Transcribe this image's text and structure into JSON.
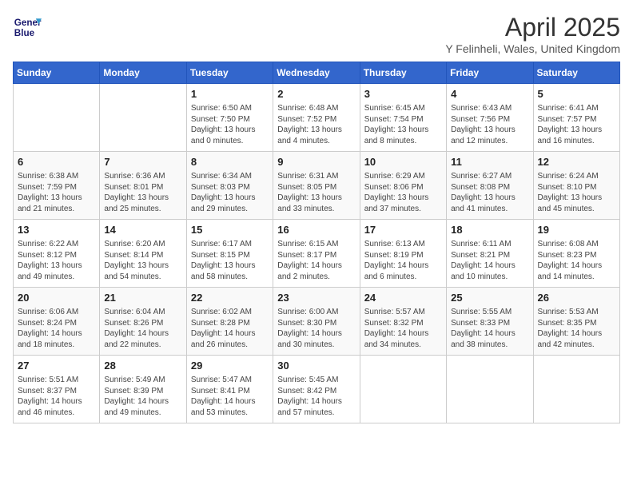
{
  "header": {
    "logo_line1": "General",
    "logo_line2": "Blue",
    "title": "April 2025",
    "subtitle": "Y Felinheli, Wales, United Kingdom"
  },
  "days_of_week": [
    "Sunday",
    "Monday",
    "Tuesday",
    "Wednesday",
    "Thursday",
    "Friday",
    "Saturday"
  ],
  "weeks": [
    [
      {
        "day": "",
        "info": ""
      },
      {
        "day": "",
        "info": ""
      },
      {
        "day": "1",
        "info": "Sunrise: 6:50 AM\nSunset: 7:50 PM\nDaylight: 13 hours and 0 minutes."
      },
      {
        "day": "2",
        "info": "Sunrise: 6:48 AM\nSunset: 7:52 PM\nDaylight: 13 hours and 4 minutes."
      },
      {
        "day": "3",
        "info": "Sunrise: 6:45 AM\nSunset: 7:54 PM\nDaylight: 13 hours and 8 minutes."
      },
      {
        "day": "4",
        "info": "Sunrise: 6:43 AM\nSunset: 7:56 PM\nDaylight: 13 hours and 12 minutes."
      },
      {
        "day": "5",
        "info": "Sunrise: 6:41 AM\nSunset: 7:57 PM\nDaylight: 13 hours and 16 minutes."
      }
    ],
    [
      {
        "day": "6",
        "info": "Sunrise: 6:38 AM\nSunset: 7:59 PM\nDaylight: 13 hours and 21 minutes."
      },
      {
        "day": "7",
        "info": "Sunrise: 6:36 AM\nSunset: 8:01 PM\nDaylight: 13 hours and 25 minutes."
      },
      {
        "day": "8",
        "info": "Sunrise: 6:34 AM\nSunset: 8:03 PM\nDaylight: 13 hours and 29 minutes."
      },
      {
        "day": "9",
        "info": "Sunrise: 6:31 AM\nSunset: 8:05 PM\nDaylight: 13 hours and 33 minutes."
      },
      {
        "day": "10",
        "info": "Sunrise: 6:29 AM\nSunset: 8:06 PM\nDaylight: 13 hours and 37 minutes."
      },
      {
        "day": "11",
        "info": "Sunrise: 6:27 AM\nSunset: 8:08 PM\nDaylight: 13 hours and 41 minutes."
      },
      {
        "day": "12",
        "info": "Sunrise: 6:24 AM\nSunset: 8:10 PM\nDaylight: 13 hours and 45 minutes."
      }
    ],
    [
      {
        "day": "13",
        "info": "Sunrise: 6:22 AM\nSunset: 8:12 PM\nDaylight: 13 hours and 49 minutes."
      },
      {
        "day": "14",
        "info": "Sunrise: 6:20 AM\nSunset: 8:14 PM\nDaylight: 13 hours and 54 minutes."
      },
      {
        "day": "15",
        "info": "Sunrise: 6:17 AM\nSunset: 8:15 PM\nDaylight: 13 hours and 58 minutes."
      },
      {
        "day": "16",
        "info": "Sunrise: 6:15 AM\nSunset: 8:17 PM\nDaylight: 14 hours and 2 minutes."
      },
      {
        "day": "17",
        "info": "Sunrise: 6:13 AM\nSunset: 8:19 PM\nDaylight: 14 hours and 6 minutes."
      },
      {
        "day": "18",
        "info": "Sunrise: 6:11 AM\nSunset: 8:21 PM\nDaylight: 14 hours and 10 minutes."
      },
      {
        "day": "19",
        "info": "Sunrise: 6:08 AM\nSunset: 8:23 PM\nDaylight: 14 hours and 14 minutes."
      }
    ],
    [
      {
        "day": "20",
        "info": "Sunrise: 6:06 AM\nSunset: 8:24 PM\nDaylight: 14 hours and 18 minutes."
      },
      {
        "day": "21",
        "info": "Sunrise: 6:04 AM\nSunset: 8:26 PM\nDaylight: 14 hours and 22 minutes."
      },
      {
        "day": "22",
        "info": "Sunrise: 6:02 AM\nSunset: 8:28 PM\nDaylight: 14 hours and 26 minutes."
      },
      {
        "day": "23",
        "info": "Sunrise: 6:00 AM\nSunset: 8:30 PM\nDaylight: 14 hours and 30 minutes."
      },
      {
        "day": "24",
        "info": "Sunrise: 5:57 AM\nSunset: 8:32 PM\nDaylight: 14 hours and 34 minutes."
      },
      {
        "day": "25",
        "info": "Sunrise: 5:55 AM\nSunset: 8:33 PM\nDaylight: 14 hours and 38 minutes."
      },
      {
        "day": "26",
        "info": "Sunrise: 5:53 AM\nSunset: 8:35 PM\nDaylight: 14 hours and 42 minutes."
      }
    ],
    [
      {
        "day": "27",
        "info": "Sunrise: 5:51 AM\nSunset: 8:37 PM\nDaylight: 14 hours and 46 minutes."
      },
      {
        "day": "28",
        "info": "Sunrise: 5:49 AM\nSunset: 8:39 PM\nDaylight: 14 hours and 49 minutes."
      },
      {
        "day": "29",
        "info": "Sunrise: 5:47 AM\nSunset: 8:41 PM\nDaylight: 14 hours and 53 minutes."
      },
      {
        "day": "30",
        "info": "Sunrise: 5:45 AM\nSunset: 8:42 PM\nDaylight: 14 hours and 57 minutes."
      },
      {
        "day": "",
        "info": ""
      },
      {
        "day": "",
        "info": ""
      },
      {
        "day": "",
        "info": ""
      }
    ]
  ]
}
